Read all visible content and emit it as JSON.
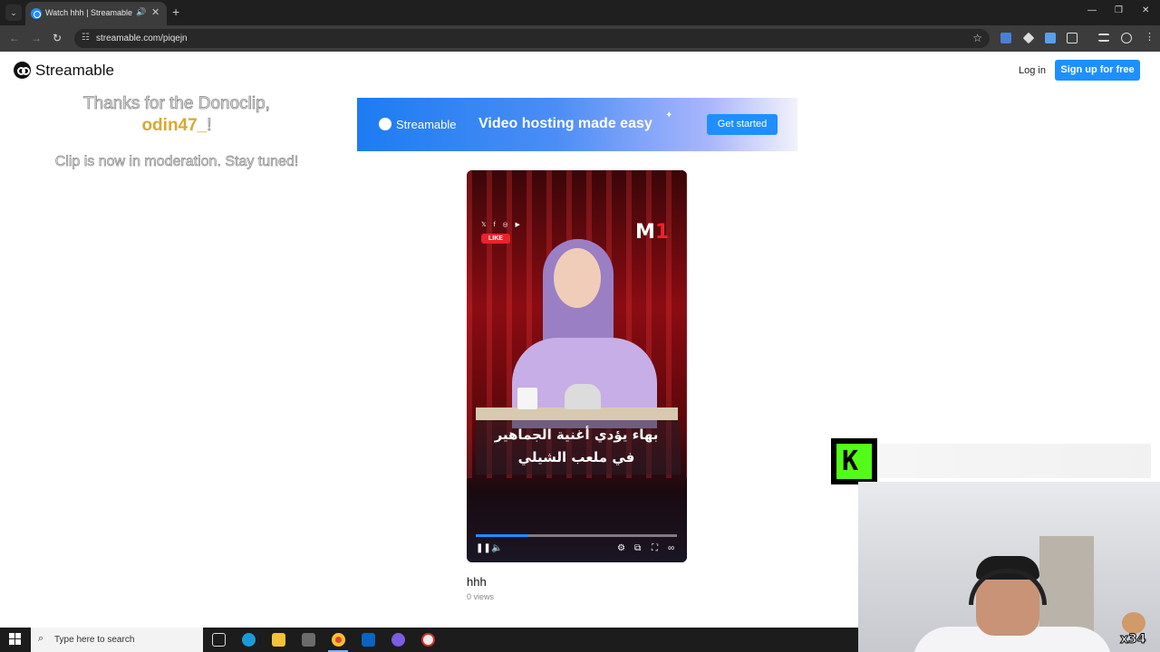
{
  "browser": {
    "tab_title": "Watch hhh | Streamable",
    "tab_search_icon": "⌄",
    "tab_audio_icon": "🔊",
    "tab_close_icon": "✕",
    "new_tab_icon": "+",
    "url": "streamable.com/piqejn",
    "window_minimize_icon": "—",
    "window_restore_icon": "❐",
    "window_close_icon": "✕",
    "back_icon": "←",
    "forward_icon": "→",
    "reload_icon": "↻",
    "site_info_icon": "☷",
    "bookmark_icon": "☆"
  },
  "header": {
    "brand": "Streamable",
    "login": "Log in",
    "signup": "Sign up for free"
  },
  "donation": {
    "line1": "Thanks for the Donoclip,",
    "name": "odin47_",
    "bang": "!",
    "line3": "Clip is now in moderation. Stay tuned!"
  },
  "banner": {
    "brand": "Streamable",
    "tagline": "Video hosting made easy",
    "cta": "Get started"
  },
  "video": {
    "caption_line1": "بهاء يؤدي أغنية الجماهير",
    "caption_line2": "في ملعب الشيلي",
    "social_icons": "𝕏 f ◎ ▶",
    "like_label": "LIKE",
    "channel_logo": "M",
    "channel_logo_suffix": "1",
    "progress": 0.26,
    "title": "hhh",
    "views": "0 views",
    "pause_icon": "❚❚",
    "volume_icon": "🔈",
    "settings_icon": "⚙",
    "pip_icon": "⧉",
    "fullscreen_icon": "⛶",
    "streamable_icon": "∞"
  },
  "overlay": {
    "kick_letter": "K",
    "counter": "x34"
  },
  "taskbar": {
    "search_placeholder": "Type here to search",
    "search_icon": "⌕",
    "start_icon_colors": [
      "#ffffff"
    ]
  },
  "colors": {
    "accent": "#1f8fff",
    "donor_name": "#d9a830",
    "kick_green": "#53fc18"
  }
}
